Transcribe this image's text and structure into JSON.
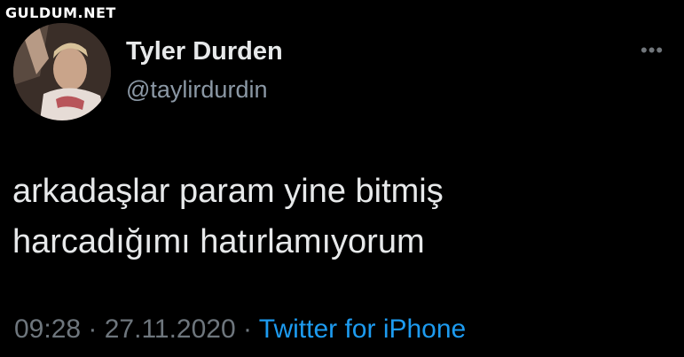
{
  "watermark": {
    "text": "GULDUM.NET"
  },
  "author": {
    "avatar_icon": "profile-photo",
    "display_name": "Tyler Durden",
    "handle": "@taylirdurdin"
  },
  "more_icon": "more-horizontal-icon",
  "more_label": "•••",
  "tweet": {
    "lines": [
      "arkadaşlar param yine bitmiş",
      "harcadığımı hatırlamıyorum"
    ]
  },
  "meta": {
    "time": "09:28",
    "separator": " · ",
    "date": "27.11.2020",
    "source": "Twitter for iPhone"
  },
  "colors": {
    "background": "#000000",
    "text": "#e7e9ea",
    "secondary": "#6e767d",
    "link": "#1d9bf0"
  }
}
